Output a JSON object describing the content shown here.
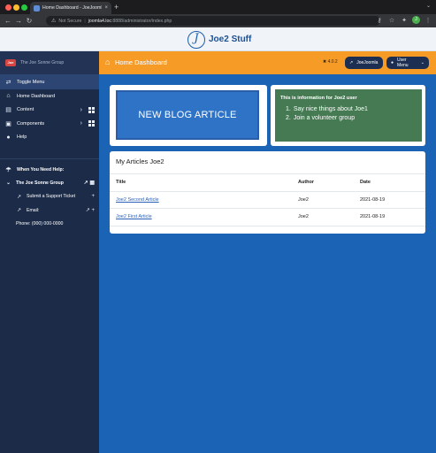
{
  "browser": {
    "tab_title": "Home Dashboard - JoeJoomla4",
    "tab_close": "×",
    "new_tab": "+",
    "url": {
      "security": "Not Secure",
      "separator": "|",
      "host": "joomla4.loc",
      "rest": ":8888/administrator/index.php"
    },
    "profile_initial": "J"
  },
  "site": {
    "logo_glyph": "J",
    "title": "Joe2 Stuff"
  },
  "sidebar": {
    "brand_logo": "Joe",
    "brand_name": "The Joe Sonne Group",
    "items": [
      {
        "label": "Toggle Menu",
        "icon": "toggle-icon"
      },
      {
        "label": "Home Dashboard",
        "icon": "home-icon"
      },
      {
        "label": "Content",
        "icon": "file-icon"
      },
      {
        "label": "Components",
        "icon": "cube-icon"
      },
      {
        "label": "Help",
        "icon": "info-icon"
      }
    ],
    "help_section": {
      "title": "When You Need Help:",
      "group": "The Joe Sonne Group",
      "support": "Submit a Support Ticket",
      "email": "Email:",
      "phone": "Phone: (000) 000-0000"
    }
  },
  "toolbar": {
    "title": "Home Dashboard",
    "version": "4.0.2",
    "site_button": "JoeJoomla",
    "user_button": "User Menu"
  },
  "blog_button": {
    "label": "NEW BLOG ARTICLE"
  },
  "info_card": {
    "title": "This is information for Joe2 user",
    "items": [
      "Say nice things about Joe1",
      "Join a volunteer group"
    ]
  },
  "articles": {
    "heading": "My Articles Joe2",
    "columns": [
      "Title",
      "Author",
      "Date"
    ],
    "rows": [
      {
        "title": "Joe2 Second Article",
        "author": "Joe2",
        "date": "2021-08-19"
      },
      {
        "title": "Joe2 First Article",
        "author": "Joe2",
        "date": "2021-08-19"
      }
    ]
  },
  "colors": {
    "header_orange": "#f79b27",
    "sidebar_navy": "#1c2b48",
    "main_blue": "#1a63b5",
    "info_green": "#457a53",
    "blog_blue": "#2f73c7"
  }
}
